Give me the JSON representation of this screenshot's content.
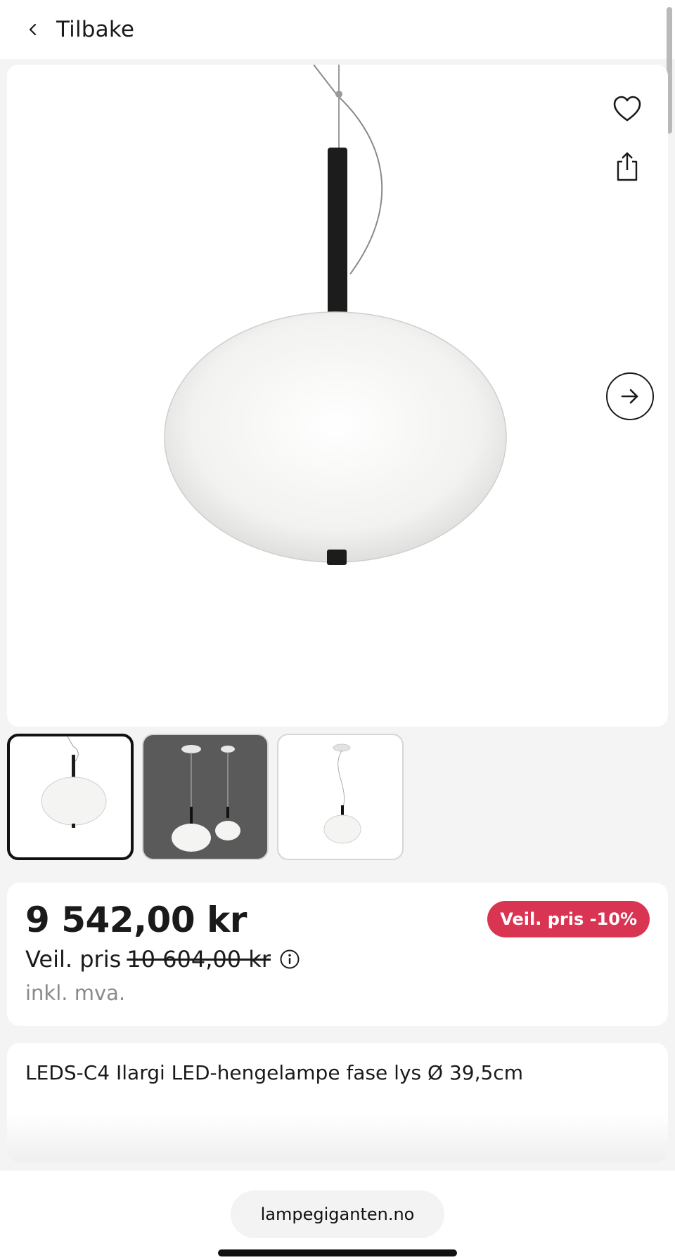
{
  "header": {
    "back_label": "Tilbake"
  },
  "icons": {
    "back": "chevron-left-icon",
    "favorite": "heart-icon",
    "share": "share-icon",
    "next": "arrow-right-icon",
    "info": "info-icon"
  },
  "product": {
    "price": "9 542,00 kr",
    "recommended_label": "Veil. pris",
    "recommended_price": "10 604,00 kr",
    "vat_note": "inkl. mva.",
    "discount_badge": "Veil. pris -10%",
    "title": "LEDS-C4 Ilargi LED-hengelampe fase lys Ø 39,5cm"
  },
  "gallery": {
    "thumbnail_count": 3,
    "active_index": 0
  },
  "browser": {
    "url": "lampegiganten.no"
  },
  "colors": {
    "badge": "#d93452",
    "text": "#1a1a1a",
    "muted": "#8a8a8a"
  }
}
